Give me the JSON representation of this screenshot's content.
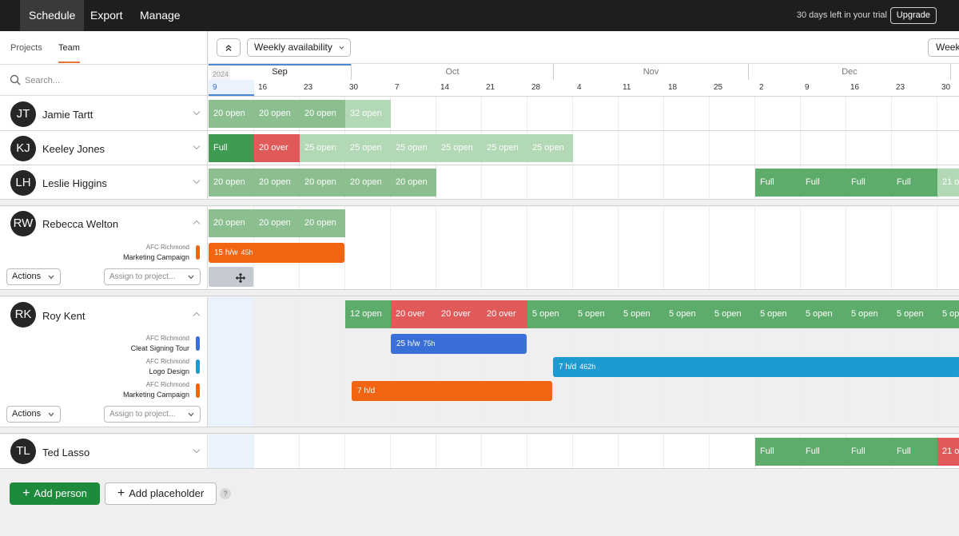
{
  "nav": {
    "items": [
      "Schedule",
      "Export",
      "Manage"
    ],
    "trial_text": "30 days left in your trial",
    "upgrade_label": "Upgrade"
  },
  "sidebar": {
    "tabs": [
      "Projects",
      "Team"
    ],
    "search_placeholder": "Search..."
  },
  "toolbar": {
    "view_label": "Weekly availability",
    "weeks_label": "Weeks"
  },
  "timeline": {
    "year": "2024",
    "months": [
      "Sep",
      "Oct",
      "Nov",
      "Dec"
    ],
    "weeks": [
      "9",
      "16",
      "23",
      "30",
      "7",
      "14",
      "21",
      "28",
      "4",
      "11",
      "18",
      "25",
      "2",
      "9",
      "16",
      "23",
      "30"
    ]
  },
  "people": [
    {
      "initials": "JT",
      "name": "Jamie Tartt",
      "cells": [
        [
          "20 open",
          "open"
        ],
        [
          "20 open",
          "open"
        ],
        [
          "20 open",
          "open"
        ],
        [
          "32 open",
          "open2"
        ]
      ]
    },
    {
      "initials": "KJ",
      "name": "Keeley Jones",
      "cells": [
        [
          "Full",
          "full"
        ],
        [
          "20 over",
          "over"
        ],
        [
          "25 open",
          "open2"
        ],
        [
          "25 open",
          "open2"
        ],
        [
          "25 open",
          "open2"
        ],
        [
          "25 open",
          "open2"
        ],
        [
          "25 open",
          "open2"
        ],
        [
          "25 open",
          "open2"
        ]
      ]
    },
    {
      "initials": "LH",
      "name": "Leslie Higgins",
      "cells": [
        [
          "20 open",
          "open"
        ],
        [
          "20 open",
          "open"
        ],
        [
          "20 open",
          "open"
        ],
        [
          "20 open",
          "open"
        ],
        [
          "20 open",
          "open"
        ]
      ],
      "late_cells": [
        [
          "Full",
          "mid"
        ],
        [
          "Full",
          "mid"
        ],
        [
          "Full",
          "mid"
        ],
        [
          "Full",
          "mid"
        ],
        [
          "21 o",
          "open2"
        ]
      ]
    },
    {
      "initials": "RW",
      "name": "Rebecca Welton",
      "cells": [
        [
          "20 open",
          "open"
        ],
        [
          "20 open",
          "open"
        ],
        [
          "20 open",
          "open"
        ]
      ],
      "projects": [
        {
          "client": "AFC Richmond",
          "name": "Marketing Campaign",
          "color": "#f06412",
          "rate": "15 h/w",
          "hours": "45h"
        }
      ],
      "actions_label": "Actions",
      "assign_placeholder": "Assign to project..."
    },
    {
      "initials": "RK",
      "name": "Roy Kent",
      "cells": [
        [
          "12 open",
          "mid"
        ],
        [
          "20 over",
          "over"
        ],
        [
          "20 over",
          "over"
        ],
        [
          "20 over",
          "over"
        ],
        [
          "5 open",
          "mid"
        ],
        [
          "5 open",
          "mid"
        ],
        [
          "5 open",
          "mid"
        ],
        [
          "5 open",
          "mid"
        ],
        [
          "5 open",
          "mid"
        ],
        [
          "5 open",
          "mid"
        ],
        [
          "5 open",
          "mid"
        ],
        [
          "5 open",
          "mid"
        ],
        [
          "5 open",
          "mid"
        ],
        [
          "5 op",
          "mid"
        ]
      ],
      "projects": [
        {
          "client": "AFC Richmond",
          "name": "Cleat Signing Tour",
          "color": "#3a6fd8",
          "rate": "25 h/w",
          "hours": "75h"
        },
        {
          "client": "AFC Richmond",
          "name": "Logo Design",
          "color": "#1d9bd1",
          "rate": "7 h/d",
          "hours": "462h"
        },
        {
          "client": "AFC Richmond",
          "name": "Marketing Campaign",
          "color": "#f06412",
          "rate": "7 h/d",
          "hours": ""
        }
      ],
      "actions_label": "Actions",
      "assign_placeholder": "Assign to project..."
    },
    {
      "initials": "TL",
      "name": "Ted Lasso",
      "late_cells": [
        [
          "Full",
          "mid"
        ],
        [
          "Full",
          "mid"
        ],
        [
          "Full",
          "mid"
        ],
        [
          "Full",
          "mid"
        ],
        [
          "21 o",
          "over"
        ]
      ]
    }
  ],
  "footer": {
    "add_person_label": "Add person",
    "add_placeholder_label": "Add placeholder",
    "help": "?"
  },
  "colors": {
    "open": "#8bbf90",
    "open_light": "#b3d8b6",
    "full": "#3f9b52",
    "over": "#e05a5a",
    "accent": "#1e8a3c"
  }
}
